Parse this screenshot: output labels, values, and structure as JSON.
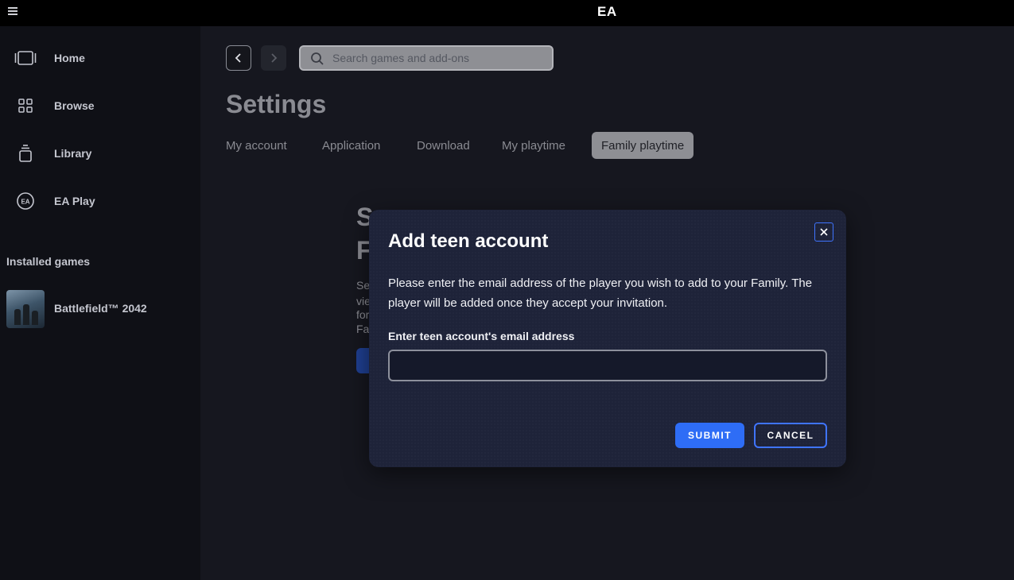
{
  "titlebar": {
    "app_logo": "EA",
    "menu_icon": "hamburger-menu-icon"
  },
  "sidebar": {
    "items": [
      {
        "label": "Home",
        "icon": "home-icon"
      },
      {
        "label": "Browse",
        "icon": "grid-icon"
      },
      {
        "label": "Library",
        "icon": "library-icon"
      },
      {
        "label": "EA Play",
        "icon": "ea-play-icon"
      }
    ],
    "installed_title": "Installed games",
    "installed_games": [
      {
        "title": "Battlefield™ 2042"
      }
    ]
  },
  "header": {
    "search_placeholder": "Search games and add-ons",
    "page_title": "Settings",
    "tabs": [
      {
        "label": "My account",
        "active": false
      },
      {
        "label": "Application",
        "active": false
      },
      {
        "label": "Download",
        "active": false
      },
      {
        "label": "My playtime",
        "active": false
      },
      {
        "label": "Family playtime",
        "active": true
      }
    ]
  },
  "background_content": {
    "heading_line1": "S",
    "heading_line2": "F",
    "text_lines": [
      "Se",
      "vie",
      "for",
      "Fa"
    ]
  },
  "modal": {
    "title": "Add teen account",
    "description": "Please enter the email address of the player you wish to add to your Family. The player will be added once they accept your invitation.",
    "field_label": "Enter teen account's email address",
    "email_value": "",
    "submit_label": "SUBMIT",
    "cancel_label": "CANCEL"
  },
  "colors": {
    "accent": "#2e6df6",
    "focus_border": "#3f74ff",
    "modal_bg": "#1e2339",
    "active_tab_bg": "#8e8f94"
  }
}
